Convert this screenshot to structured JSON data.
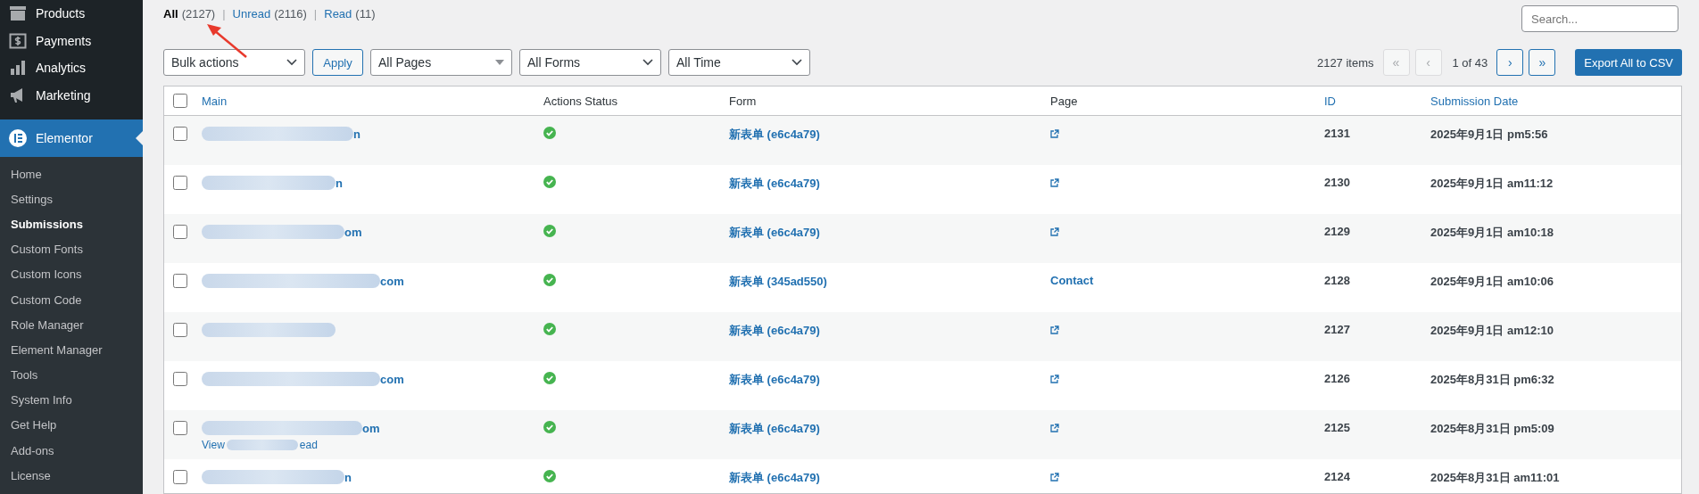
{
  "sidebar": {
    "menu": [
      {
        "label": "Products",
        "selected": false
      },
      {
        "label": "Payments",
        "selected": false
      },
      {
        "label": "Analytics",
        "selected": false
      },
      {
        "label": "Marketing",
        "selected": false
      },
      {
        "label": "Elementor",
        "selected": true
      }
    ],
    "submenu": [
      {
        "label": "Home",
        "selected": false
      },
      {
        "label": "Settings",
        "selected": false
      },
      {
        "label": "Submissions",
        "selected": true
      },
      {
        "label": "Custom Fonts",
        "selected": false
      },
      {
        "label": "Custom Icons",
        "selected": false
      },
      {
        "label": "Custom Code",
        "selected": false
      },
      {
        "label": "Role Manager",
        "selected": false
      },
      {
        "label": "Element Manager",
        "selected": false
      },
      {
        "label": "Tools",
        "selected": false
      },
      {
        "label": "System Info",
        "selected": false
      },
      {
        "label": "Get Help",
        "selected": false
      },
      {
        "label": "Add-ons",
        "selected": false
      },
      {
        "label": "License",
        "selected": false
      }
    ]
  },
  "views": [
    {
      "label": "All",
      "count": "(2127)",
      "selected": true
    },
    {
      "separator": "|",
      "label": "Unread",
      "count": "(2116)",
      "selected": false
    },
    {
      "separator": "|",
      "label": "Read",
      "count": "(11)",
      "selected": false
    }
  ],
  "search": {
    "placeholder": "Search..."
  },
  "filters": [
    {
      "label": "Bulk actions",
      "kind": "select"
    },
    {
      "label": "All Pages",
      "kind": "combo"
    },
    {
      "label": "All Forms",
      "kind": "select"
    },
    {
      "label": "All Time",
      "kind": "select"
    }
  ],
  "apply_button": "Apply",
  "pagination": {
    "count": "2127 items",
    "current": "1 of 43",
    "buttons": [
      {
        "label": "«",
        "disabled": true
      },
      {
        "label": "‹",
        "disabled": true
      },
      {
        "label": "›",
        "disabled": false
      },
      {
        "label": "»",
        "disabled": false
      }
    ]
  },
  "export_button": "Export All to CSV",
  "table": {
    "select_all_checked": false,
    "columns": [
      {
        "label": "Main",
        "sortable": true
      },
      {
        "label": "Actions Status",
        "sortable": false
      },
      {
        "label": "Form",
        "sortable": false
      },
      {
        "label": "Page",
        "sortable": false
      },
      {
        "label": "ID",
        "sortable": true
      },
      {
        "label": "Submission Date",
        "sortable": true
      }
    ],
    "rows": [
      {
        "checked": false,
        "main": "n",
        "success": true,
        "form": "新表单 (e6c4a79)",
        "page": {
          "kind": "icon"
        },
        "id": "2131",
        "date": "2025年9月1日 pm5:56"
      },
      {
        "checked": false,
        "main": "n",
        "success": true,
        "form": "新表单 (e6c4a79)",
        "page": {
          "kind": "icon"
        },
        "id": "2130",
        "date": "2025年9月1日 am11:12"
      },
      {
        "checked": false,
        "main": "om",
        "success": true,
        "form": "新表单 (e6c4a79)",
        "page": {
          "kind": "icon"
        },
        "id": "2129",
        "date": "2025年9月1日 am10:18"
      },
      {
        "checked": false,
        "main": "com",
        "success": true,
        "form": "新表单 (345ad550)",
        "page": {
          "kind": "link",
          "text": "Contact"
        },
        "id": "2128",
        "date": "2025年9月1日 am10:06"
      },
      {
        "checked": false,
        "success": true,
        "form": "新表单 (e6c4a79)",
        "page": {
          "kind": "icon"
        },
        "id": "2127",
        "date": "2025年9月1日 am12:10"
      },
      {
        "checked": false,
        "main": "com",
        "success": true,
        "form": "新表单 (e6c4a79)",
        "page": {
          "kind": "icon"
        },
        "id": "2126",
        "date": "2025年8月31日 pm6:32"
      },
      {
        "checked": false,
        "main": "om",
        "actions": [
          "View",
          "ead"
        ],
        "success": true,
        "form": "新表单 (e6c4a79)",
        "page": {
          "kind": "icon"
        },
        "id": "2125",
        "date": "2025年8月31日 pm5:09"
      },
      {
        "checked": false,
        "main": "n",
        "success": true,
        "form": "新表单 (e6c4a79)",
        "page": {
          "kind": "icon"
        },
        "id": "2124",
        "date": "2025年8月31日 am11:01"
      }
    ]
  }
}
